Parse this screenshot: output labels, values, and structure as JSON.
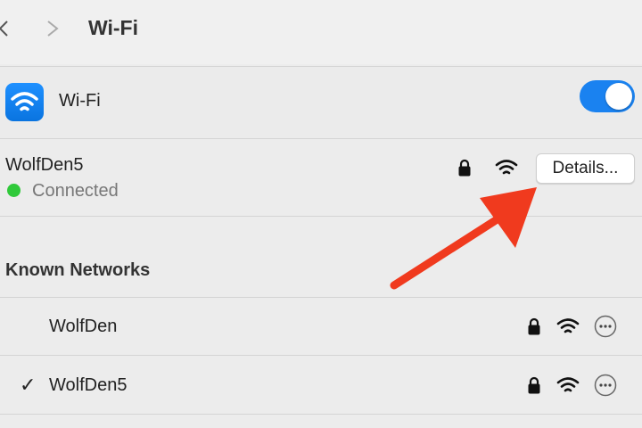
{
  "toolbar": {
    "title": "Wi-Fi"
  },
  "wifi": {
    "label": "Wi-Fi",
    "enabled": true
  },
  "current_network": {
    "name": "WolfDen5",
    "status": "Connected",
    "details_label": "Details..."
  },
  "known_networks": {
    "title": "Known Networks",
    "items": [
      {
        "name": "WolfDen",
        "connected": false
      },
      {
        "name": "WolfDen5",
        "connected": true
      }
    ]
  },
  "colors": {
    "accent": "#1a82f0",
    "connected": "#30c93a",
    "annotation_arrow": "#f03a1e"
  }
}
